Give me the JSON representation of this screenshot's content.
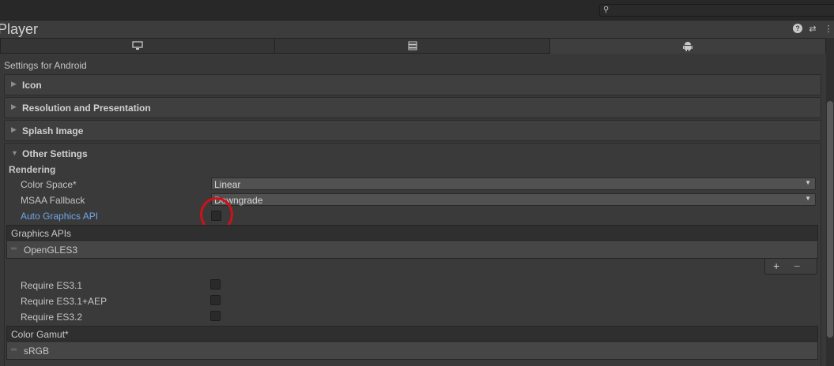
{
  "window": {
    "title": "Player",
    "search_icon": "search-icon",
    "header_icons": [
      "help-icon",
      "presets-icon",
      "more-icon"
    ],
    "help_glyph": "?",
    "presets_glyph": "⇄",
    "more_glyph": "⋮"
  },
  "tabs": [
    {
      "name": "standalone-tab",
      "icon": "monitor-icon",
      "glyph": "🖵",
      "active": false
    },
    {
      "name": "server-tab",
      "icon": "server-icon",
      "glyph": "☰",
      "active": false
    },
    {
      "name": "android-tab",
      "icon": "android-icon",
      "glyph": "🤖",
      "active": true
    }
  ],
  "settings_for": "Settings for Android",
  "foldouts": {
    "icon": "Icon",
    "resolution": "Resolution and Presentation",
    "splash": "Splash Image",
    "other": "Other Settings"
  },
  "rendering": {
    "section": "Rendering",
    "color_space_label": "Color Space*",
    "color_space_value": "Linear",
    "msaa_label": "MSAA Fallback",
    "msaa_value": "Downgrade",
    "auto_graphics_label": "Auto Graphics API",
    "auto_graphics_checked": false
  },
  "graphics_apis": {
    "header": "Graphics APIs",
    "items": [
      "OpenGLES3"
    ],
    "add": "+",
    "remove": "−"
  },
  "requires": [
    {
      "label": "Require ES3.1",
      "checked": false
    },
    {
      "label": "Require ES3.1+AEP",
      "checked": false
    },
    {
      "label": "Require ES3.2",
      "checked": false
    }
  ],
  "color_gamut": {
    "header": "Color Gamut*",
    "items": [
      "sRGB"
    ]
  },
  "colors": {
    "highlight": "#d1101a",
    "link": "#6fa6e8"
  }
}
